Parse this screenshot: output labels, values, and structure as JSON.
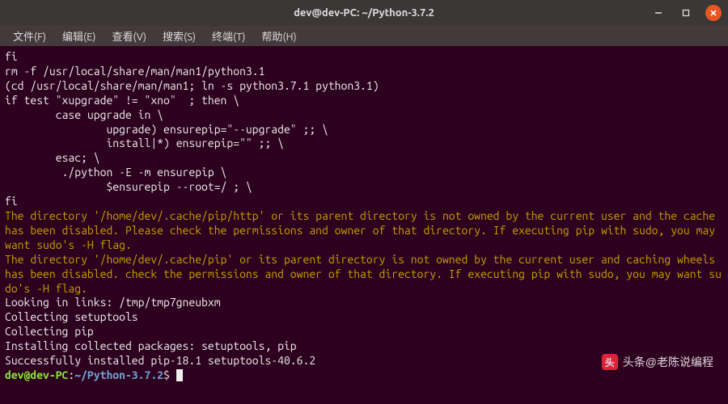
{
  "window": {
    "title": "dev@dev-PC: ~/Python-3.7.2"
  },
  "menubar": {
    "items": [
      "文件(F)",
      "编辑(E)",
      "查看(V)",
      "搜索(S)",
      "终端(T)",
      "帮助(H)"
    ]
  },
  "terminal": {
    "block_white_1": "fi\nrm -f /usr/local/share/man/man1/python3.1\n(cd /usr/local/share/man/man1; ln -s python3.7.1 python3.1)\nif test \"xupgrade\" != \"xno\"  ; then \\\n        case upgrade in \\\n                upgrade) ensurepip=\"--upgrade\" ;; \\\n                install|*) ensurepip=\"\" ;; \\\n        esac; \\\n         ./python -E -m ensurepip \\\n                $ensurepip --root=/ ; \\\nfi",
    "block_yellow": "The directory '/home/dev/.cache/pip/http' or its parent directory is not owned by the current user and the cache has been disabled. Please check the permissions and owner of that directory. If executing pip with sudo, you may want sudo's -H flag.\nThe directory '/home/dev/.cache/pip' or its parent directory is not owned by the current user and caching wheels has been disabled. check the permissions and owner of that directory. If executing pip with sudo, you may want sudo's -H flag.",
    "block_white_2": "Looking in links: /tmp/tmp7gneubxm\nCollecting setuptools\nCollecting pip\nInstalling collected packages: setuptools, pip\nSuccessfully installed pip-18.1 setuptools-40.6.2",
    "prompt": {
      "user_host": "dev@dev-PC",
      "sep": ":",
      "path": "~/Python-3.7.2",
      "symbol": "$"
    }
  },
  "watermark": {
    "icon_glyph": "头",
    "text": "头条@老陈说编程"
  }
}
